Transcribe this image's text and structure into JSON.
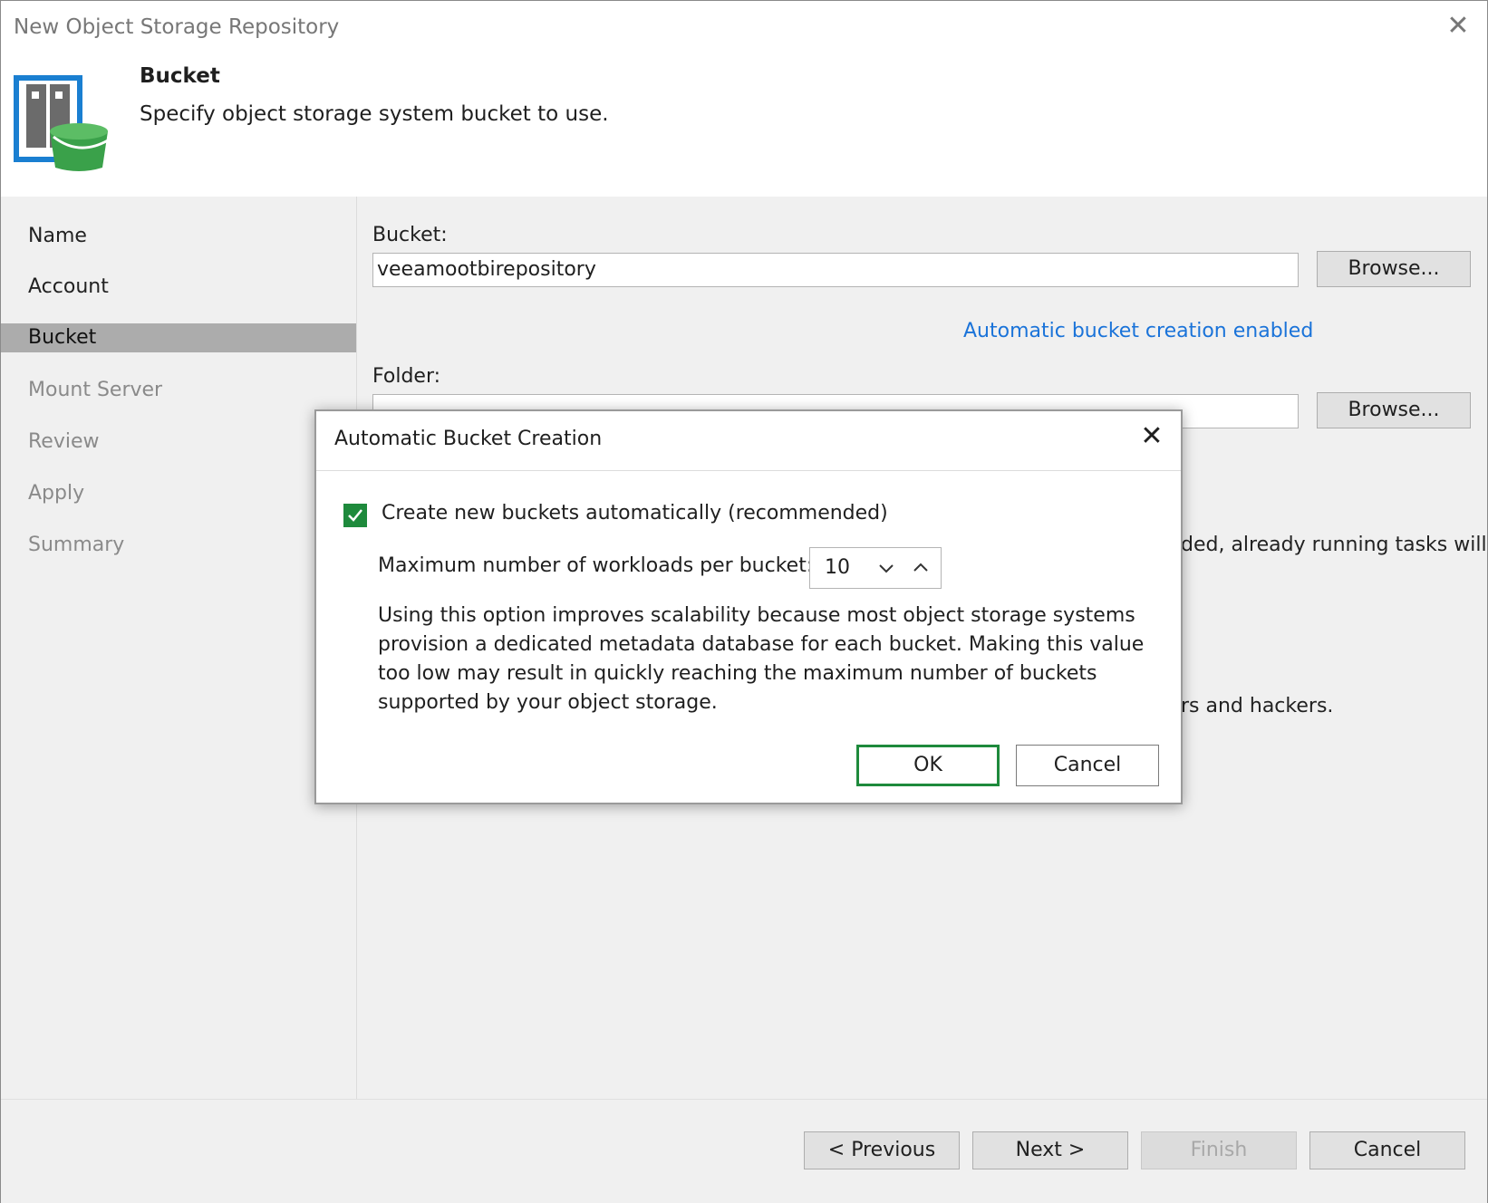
{
  "window": {
    "title": "New Object Storage Repository",
    "close_icon": "close-icon"
  },
  "header": {
    "title": "Bucket",
    "subtitle": "Specify object storage system bucket to use.",
    "icon": "object-storage-bucket-icon"
  },
  "nav": {
    "items": [
      {
        "label": "Name",
        "state": "done"
      },
      {
        "label": "Account",
        "state": "done"
      },
      {
        "label": "Bucket",
        "state": "active"
      },
      {
        "label": "Mount Server",
        "state": "todo"
      },
      {
        "label": "Review",
        "state": "todo"
      },
      {
        "label": "Apply",
        "state": "todo"
      },
      {
        "label": "Summary",
        "state": "todo"
      }
    ]
  },
  "content": {
    "bucket_label": "Bucket:",
    "bucket_value": "veeamootbirepository",
    "browse_label": "Browse...",
    "auto_link": "Automatic bucket creation enabled",
    "folder_label": "Folder:",
    "folder_browse_label": "Browse...",
    "partial_text_1": "ded, already running tasks will",
    "partial_text_2": "rs and hackers."
  },
  "dialog": {
    "title": "Automatic Bucket Creation",
    "checkbox_label": "Create new buckets automatically (recommended)",
    "checkbox_checked": true,
    "max_label": "Maximum number of workloads per bucket:",
    "max_value": "10",
    "description": "Using this option improves scalability because most object storage systems provision a dedicated metadata database for each bucket. Making this value too low may result in quickly reaching the maximum number of buckets supported by your object storage.",
    "ok_label": "OK",
    "cancel_label": "Cancel"
  },
  "footer": {
    "previous_label": "< Previous",
    "next_label": "Next >",
    "finish_label": "Finish",
    "cancel_label": "Cancel"
  },
  "colors": {
    "accent_green": "#1e8a3c",
    "link_blue": "#1a73d9",
    "nav_active": "#acacac"
  }
}
